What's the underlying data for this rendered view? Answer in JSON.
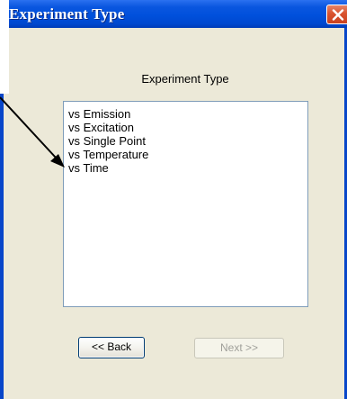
{
  "window": {
    "title": "Experiment Type",
    "titlebar_color": "#0050dc",
    "client_bg": "#ece9d8",
    "close_icon": "close-icon"
  },
  "panel": {
    "group_label": "Experiment Type",
    "items": [
      {
        "label": "vs Emission"
      },
      {
        "label": "vs Excitation"
      },
      {
        "label": "vs Single Point"
      },
      {
        "label": "vs Temperature"
      },
      {
        "label": "vs Time"
      }
    ]
  },
  "buttons": {
    "back_label": "<< Back",
    "next_label": "Next >>",
    "next_enabled": false
  },
  "annotation": {
    "icon": "pointer-arrow-icon",
    "color": "#000000"
  }
}
